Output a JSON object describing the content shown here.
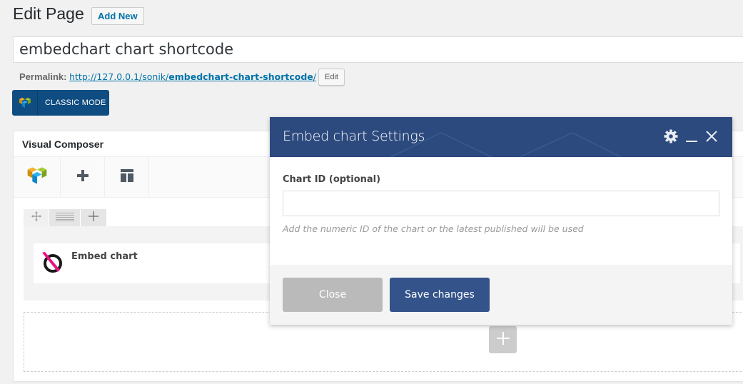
{
  "header": {
    "title": "Edit Page",
    "add_new_label": "Add New"
  },
  "post": {
    "title_value": "embedchart chart shortcode",
    "permalink_label": "Permalink:",
    "permalink_base": "http://127.0.0.1/sonik/",
    "permalink_slug": "embedchart-chart-shortcode",
    "permalink_trailing": "/",
    "edit_slug_label": "Edit"
  },
  "classic_mode": {
    "label": "CLASSIC MODE"
  },
  "visual_composer": {
    "title": "Visual Composer",
    "toolbar": [
      {
        "icon": "vc-logo-icon"
      },
      {
        "icon": "plus-icon"
      },
      {
        "icon": "template-icon"
      }
    ],
    "row_controls": [
      {
        "icon": "move-icon"
      },
      {
        "icon": "column-layout-icon"
      },
      {
        "icon": "plus-icon"
      }
    ],
    "element": {
      "name": "Embed chart",
      "icon": "embed-chart-icon"
    }
  },
  "modal": {
    "title": "Embed chart Settings",
    "field_label": "Chart ID (optional)",
    "field_value": "",
    "field_help": "Add the numeric ID of the chart or the latest published will be used",
    "close_label": "Close",
    "save_label": "Save changes"
  },
  "colors": {
    "modal_header": "#2c4a7e",
    "save_button": "#33538a",
    "classic_mode": "#0f4c81",
    "link": "#0073aa",
    "embed_accent": "#e6157e"
  }
}
